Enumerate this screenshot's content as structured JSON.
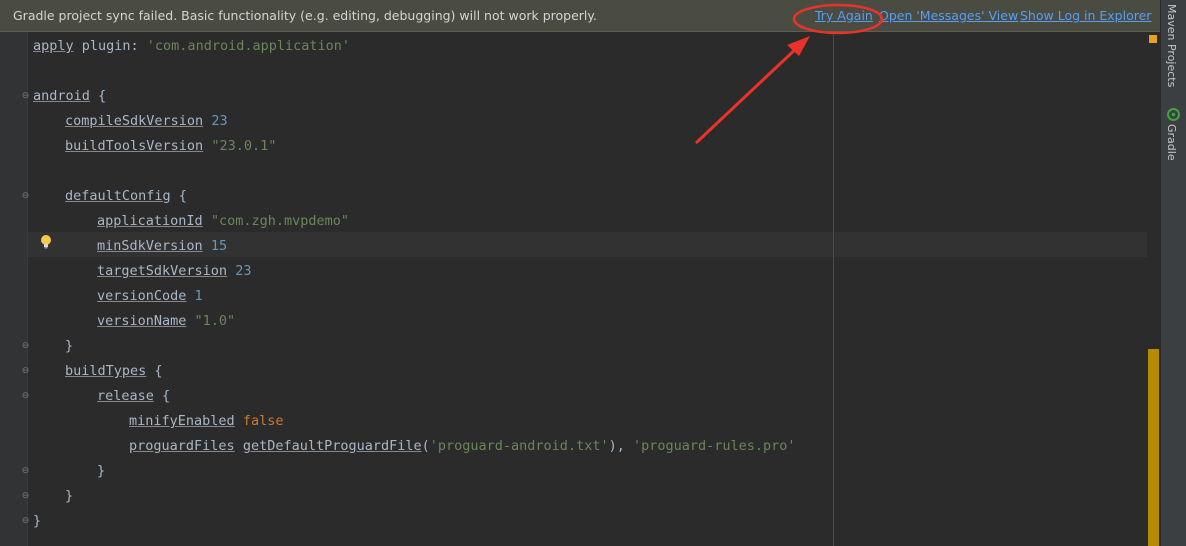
{
  "banner": {
    "message": "Gradle project sync failed. Basic functionality (e.g. editing, debugging) will not work properly.",
    "try_again": "Try Again",
    "open_messages": "Open 'Messages' View",
    "show_log": "Show Log in Explorer"
  },
  "code": {
    "l1": {
      "kw": "apply",
      "rest": " plugin: ",
      "str": "'com.android.application'"
    },
    "l3": {
      "kw": "android",
      "rest": " {"
    },
    "l4": {
      "kw": "compileSdkVersion",
      "num": "23"
    },
    "l5": {
      "kw": "buildToolsVersion",
      "str": "\"23.0.1\""
    },
    "l7": {
      "kw": "defaultConfig",
      "rest": " {"
    },
    "l8": {
      "kw": "applicationId",
      "str": "\"com.zgh.mvpdemo\""
    },
    "l9": {
      "kw": "minSdkVersion",
      "num": "15"
    },
    "l10": {
      "kw": "targetSdkVersion",
      "num": "23"
    },
    "l11": {
      "kw": "versionCode",
      "num": "1"
    },
    "l12": {
      "kw": "versionName",
      "str": "\"1.0\""
    },
    "l13": {
      "rest": "}"
    },
    "l14": {
      "kw": "buildTypes",
      "rest": " {"
    },
    "l15": {
      "kw": "release",
      "rest": " {"
    },
    "l16": {
      "kw": "minifyEnabled",
      "bool": "false"
    },
    "l17": {
      "kw": "proguardFiles",
      "fn": "getDefaultProguardFile",
      "open": "(",
      "str1": "'proguard-android.txt'",
      "mid": "), ",
      "str2": "'proguard-rules.pro'"
    },
    "l18": {
      "rest": "}"
    },
    "l19": {
      "rest": "}"
    },
    "l20": {
      "rest": "}"
    }
  },
  "side_tools": {
    "maven": "Maven Projects",
    "gradle": "Gradle"
  },
  "colors": {
    "annotation": "#e8322a",
    "link": "#589df6",
    "string": "#6a8759",
    "number": "#6897bb",
    "keyword_bool": "#cc7832"
  }
}
